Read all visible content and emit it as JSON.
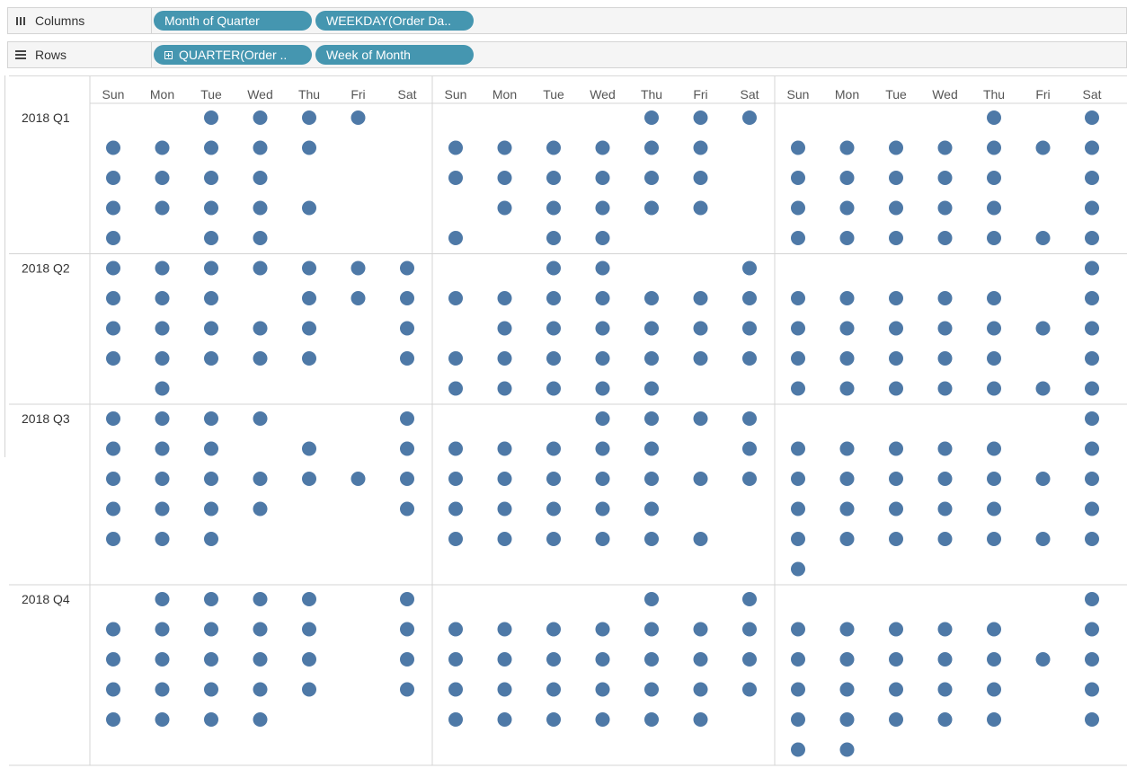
{
  "shelves": {
    "columns": {
      "label": "Columns",
      "pills": [
        "Month of Quarter",
        "WEEKDAY(Order Da.."
      ]
    },
    "rows": {
      "label": "Rows",
      "pills": [
        "QUARTER(Order ..",
        "Week of Month"
      ]
    }
  },
  "colors": {
    "pill": "#4596b0",
    "mark": "#4e79a7",
    "grid": "#d4d4d4"
  },
  "chart_data": {
    "type": "scatter",
    "column_dimensions": [
      "Month of Quarter",
      "WEEKDAY(Order Date)"
    ],
    "row_dimensions": [
      "QUARTER(Order Date)",
      "Week of Month"
    ],
    "months_of_quarter": 3,
    "weekdays": [
      "Sun",
      "Mon",
      "Tue",
      "Wed",
      "Thu",
      "Fri",
      "Sat"
    ],
    "quarters": [
      "2018 Q1",
      "2018 Q2",
      "2018 Q3",
      "2018 Q4"
    ],
    "rows_per_quarter": [
      5,
      5,
      6,
      6
    ],
    "marks": [
      [
        [
          "0011110",
          "1111100",
          "1111000",
          "1111100",
          "1011000"
        ],
        [
          "0000111",
          "1111110",
          "1111110",
          "0111110",
          "1011000"
        ],
        [
          "0000101",
          "1111111",
          "1111101",
          "1111101",
          "1111111"
        ]
      ],
      [
        [
          "1111111",
          "1110111",
          "1111101",
          "1111101",
          "0100000"
        ],
        [
          "0011001",
          "1111111",
          "0111111",
          "1111111",
          "1111100"
        ],
        [
          "0000001",
          "1111101",
          "1111111",
          "1111101",
          "1111111"
        ]
      ],
      [
        [
          "1111001",
          "1110101",
          "1111111",
          "1111001",
          "1110000",
          "0000000"
        ],
        [
          "0001111",
          "1111101",
          "1111111",
          "1111100",
          "1111110",
          "0000000"
        ],
        [
          "0000001",
          "1111101",
          "1111111",
          "1111101",
          "1111111",
          "1000000"
        ]
      ],
      [
        [
          "0111101",
          "1111101",
          "1111101",
          "1111101",
          "1111000",
          "0000000"
        ],
        [
          "0000101",
          "1111111",
          "1111111",
          "1111111",
          "1111110",
          "0000000"
        ],
        [
          "0000001",
          "1111101",
          "1111111",
          "1111101",
          "1111101",
          "1100000"
        ]
      ]
    ]
  }
}
